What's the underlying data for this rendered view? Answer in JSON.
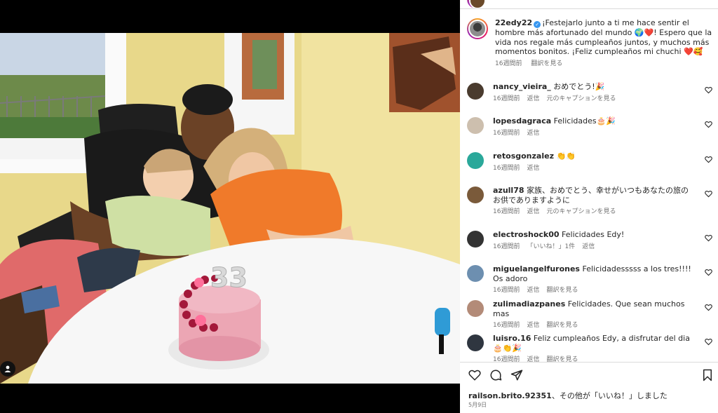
{
  "post": {
    "author": "22edy22",
    "caption": "¡Festejarlo junto a ti me hace sentir el hombre más afortunado del mundo 🌍❤️! Espero que la vida nos regale más cumpleaños juntos, y muchos más momentos bonitos. ¡Feliz cumpleaños mi chuchi ❤️🥰",
    "time": "16週間前",
    "see_translation": "翻訳を見る",
    "cake_number": "33"
  },
  "comments": [
    {
      "user": "nancy_vieira_",
      "text": "おめでとう!🎉",
      "time": "16週間前",
      "actions": [
        "返信",
        "元のキャプションを見る"
      ],
      "avatar_color": "#4a3b2e"
    },
    {
      "user": "lopesdagraca",
      "text": "Felicidades🎂🎉",
      "time": "16週間前",
      "actions": [
        "返信"
      ],
      "avatar_color": "#cdbfae"
    },
    {
      "user": "retosgonzalez",
      "text": "👏👏",
      "time": "16週間前",
      "actions": [
        "返信"
      ],
      "avatar_color": "#2aa89a"
    },
    {
      "user": "azull78",
      "text": "家族、おめでとう、幸せがいつもあなたの旅のお供でありますように",
      "time": "16週間前",
      "actions": [
        "返信",
        "元のキャプションを見る"
      ],
      "avatar_color": "#7a5a3a"
    },
    {
      "user": "electroshock00",
      "text": "Felicidades Edy!",
      "time": "16週間前",
      "actions": [
        "「いいね！」1件",
        "返信"
      ],
      "avatar_color": "#333333"
    },
    {
      "user": "miguelangelfurones",
      "text": "Felicidadesssss a los tres!!!! Os adoro",
      "time": "16週間前",
      "actions": [
        "返信",
        "翻訳を見る"
      ],
      "avatar_color": "#6d8fb0"
    },
    {
      "user": "zulimadiazpanes",
      "text": "Felicidades. Que sean muchos mas",
      "time": "16週間前",
      "actions": [
        "返信",
        "翻訳を見る"
      ],
      "avatar_color": "#b38b78"
    },
    {
      "user": "luisro.16",
      "text": "Feliz cumpleaños Edy, a disfrutar del dia 🎂👏🎉",
      "time": "16週間前",
      "actions": [
        "返信",
        "翻訳を見る"
      ],
      "avatar_color": "#2f3640"
    }
  ],
  "footer": {
    "likes_prefix": "railson.brito.92351",
    "likes_rest": "、その他が「いいね！」しました",
    "date": "5月9日"
  },
  "icons": [
    "heart-icon",
    "comment-icon",
    "share-icon",
    "save-icon",
    "user-tag-icon",
    "verified-badge-icon"
  ]
}
